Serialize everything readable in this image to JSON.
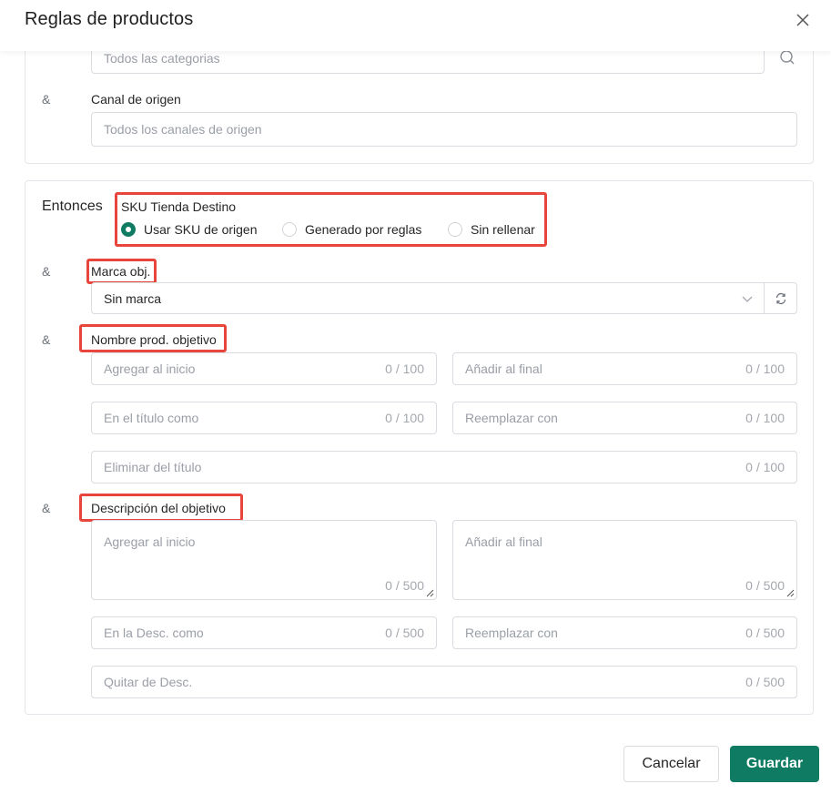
{
  "dialog": {
    "title": "Reglas de productos"
  },
  "top_section": {
    "category_placeholder": "Todos las categorias",
    "amp": "&",
    "channel_label": "Canal de origen",
    "channel_placeholder": "Todos los canales de origen"
  },
  "then_section": {
    "then_label": "Entonces",
    "sku": {
      "title": "SKU Tienda Destino",
      "options": [
        {
          "label": "Usar SKU de origen",
          "selected": true
        },
        {
          "label": "Generado por reglas",
          "selected": false
        },
        {
          "label": "Sin rellenar",
          "selected": false
        }
      ]
    },
    "brand": {
      "amp": "&",
      "label": "Marca obj.",
      "value": "Sin marca"
    },
    "name": {
      "amp": "&",
      "label": "Nombre prod. objetivo",
      "prefix_placeholder": "Agregar al inicio",
      "prefix_count": "0 / 100",
      "suffix_placeholder": "Añadir al final",
      "suffix_count": "0 / 100",
      "find_placeholder": "En el título como",
      "find_count": "0 / 100",
      "replace_placeholder": "Reemplazar con",
      "replace_count": "0 / 100",
      "remove_placeholder": "Eliminar del título",
      "remove_count": "0 / 100"
    },
    "description": {
      "amp": "&",
      "label": "Descripción del objetivo",
      "prefix_placeholder": "Agregar al inicio",
      "prefix_count": "0 / 500",
      "suffix_placeholder": "Añadir al final",
      "suffix_count": "0 / 500",
      "find_placeholder": "En la Desc. como",
      "find_count": "0 / 500",
      "replace_placeholder": "Reemplazar con",
      "replace_count": "0 / 500",
      "remove_placeholder": "Quitar de Desc.",
      "remove_count": "0 / 500"
    }
  },
  "footer": {
    "cancel_label": "Cancelar",
    "save_label": "Guardar"
  },
  "colors": {
    "accent": "#0f7b63",
    "highlight": "#e8453c",
    "border": "#d9dce1"
  }
}
